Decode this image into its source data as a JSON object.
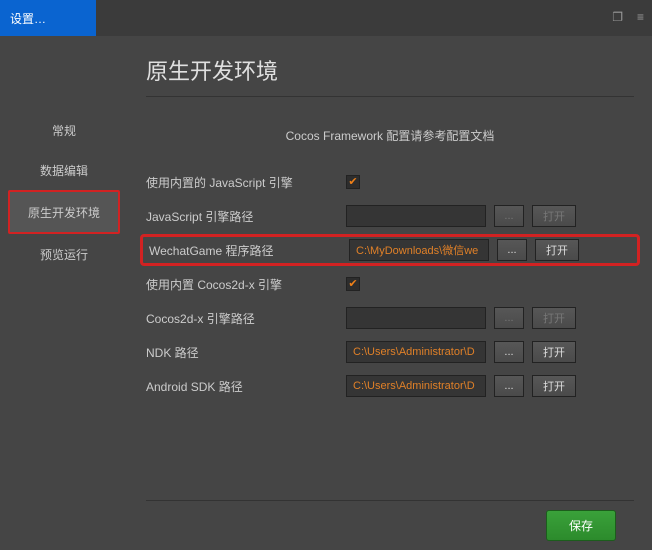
{
  "titlebar": {
    "tab_label": "设置…"
  },
  "sidebar": {
    "items": [
      {
        "label": "常规"
      },
      {
        "label": "数据编辑"
      },
      {
        "label": "原生开发环境"
      },
      {
        "label": "预览运行"
      }
    ]
  },
  "panel": {
    "title": "原生开发环境",
    "top_note": "Cocos Framework 配置请参考配置文档"
  },
  "rows": {
    "use_js": {
      "label": "使用内置的 JavaScript 引擎",
      "checked": true
    },
    "js_path": {
      "label": "JavaScript 引擎路径",
      "value": "",
      "browse": "...",
      "open": "打开",
      "enabled": false
    },
    "wechat": {
      "label": "WechatGame 程序路径",
      "value": "C:\\MyDownloads\\微信we",
      "browse": "...",
      "open": "打开",
      "enabled": true
    },
    "use_cocos": {
      "label": "使用内置 Cocos2d-x 引擎",
      "checked": true
    },
    "cocos_path": {
      "label": "Cocos2d-x 引擎路径",
      "value": "",
      "browse": "...",
      "open": "打开",
      "enabled": false
    },
    "ndk": {
      "label": "NDK 路径",
      "value": "C:\\Users\\Administrator\\D",
      "browse": "...",
      "open": "打开",
      "enabled": true
    },
    "sdk": {
      "label": "Android SDK 路径",
      "value": "C:\\Users\\Administrator\\D",
      "browse": "...",
      "open": "打开",
      "enabled": true
    }
  },
  "footer": {
    "save": "保存"
  }
}
